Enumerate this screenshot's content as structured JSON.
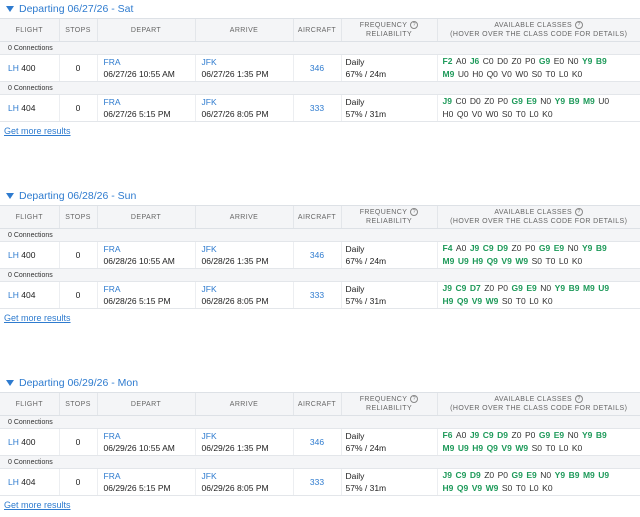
{
  "columns": {
    "flight": "FLIGHT",
    "stops": "STOPS",
    "depart": "DEPART",
    "arrive": "ARRIVE",
    "aircraft": "AIRCRAFT",
    "frequency_1": "FREQUENCY",
    "frequency_2": "RELIABILITY",
    "classes_1": "AVAILABLE CLASSES",
    "classes_2": "(HOVER OVER THE CLASS CODE FOR DETAILS)"
  },
  "get_more_label": "Get more results",
  "colors": {
    "accent": "#2e7bcf",
    "available": "#1e9a5a"
  },
  "sections": [
    {
      "title": "Departing 06/27/26 - Sat",
      "flights": [
        {
          "connections": "0 Connections",
          "airline": "LH",
          "number": "400",
          "stops": "0",
          "dep_airport": "FRA",
          "dep_time": "06/27/26 10:55 AM",
          "arr_airport": "JFK",
          "arr_time": "06/27/26 1:35 PM",
          "aircraft": "346",
          "frequency": "Daily",
          "reliability": "67% / 24m",
          "classes": [
            [
              [
                "F2",
                1
              ],
              [
                "A0",
                0
              ],
              [
                "J6",
                1
              ],
              [
                "C0",
                0
              ],
              [
                "D0",
                0
              ],
              [
                "Z0",
                0
              ],
              [
                "P0",
                0
              ],
              [
                "G9",
                1
              ],
              [
                "E0",
                0
              ],
              [
                "N0",
                0
              ],
              [
                "Y9",
                1
              ],
              [
                "B9",
                1
              ]
            ],
            [
              [
                "M9",
                1
              ],
              [
                "U0",
                0
              ],
              [
                "H0",
                0
              ],
              [
                "Q0",
                0
              ],
              [
                "V0",
                0
              ],
              [
                "W0",
                0
              ],
              [
                "S0",
                0
              ],
              [
                "T0",
                0
              ],
              [
                "L0",
                0
              ],
              [
                "K0",
                0
              ]
            ]
          ]
        },
        {
          "connections": "0 Connections",
          "airline": "LH",
          "number": "404",
          "stops": "0",
          "dep_airport": "FRA",
          "dep_time": "06/27/26 5:15 PM",
          "arr_airport": "JFK",
          "arr_time": "06/27/26 8:05 PM",
          "aircraft": "333",
          "frequency": "Daily",
          "reliability": "57% / 31m",
          "classes": [
            [
              [
                "J9",
                1
              ],
              [
                "C0",
                0
              ],
              [
                "D0",
                0
              ],
              [
                "Z0",
                0
              ],
              [
                "P0",
                0
              ],
              [
                "G9",
                1
              ],
              [
                "E9",
                1
              ],
              [
                "N0",
                0
              ],
              [
                "Y9",
                1
              ],
              [
                "B9",
                1
              ],
              [
                "M9",
                1
              ],
              [
                "U0",
                0
              ]
            ],
            [
              [
                "H0",
                0
              ],
              [
                "Q0",
                0
              ],
              [
                "V0",
                0
              ],
              [
                "W0",
                0
              ],
              [
                "S0",
                0
              ],
              [
                "T0",
                0
              ],
              [
                "L0",
                0
              ],
              [
                "K0",
                0
              ]
            ]
          ]
        }
      ]
    },
    {
      "title": "Departing 06/28/26 - Sun",
      "flights": [
        {
          "connections": "0 Connections",
          "airline": "LH",
          "number": "400",
          "stops": "0",
          "dep_airport": "FRA",
          "dep_time": "06/28/26 10:55 AM",
          "arr_airport": "JFK",
          "arr_time": "06/28/26 1:35 PM",
          "aircraft": "346",
          "frequency": "Daily",
          "reliability": "67% / 24m",
          "classes": [
            [
              [
                "F4",
                1
              ],
              [
                "A0",
                0
              ],
              [
                "J9",
                1
              ],
              [
                "C9",
                1
              ],
              [
                "D9",
                1
              ],
              [
                "Z0",
                0
              ],
              [
                "P0",
                0
              ],
              [
                "G9",
                1
              ],
              [
                "E9",
                1
              ],
              [
                "N0",
                0
              ],
              [
                "Y9",
                1
              ],
              [
                "B9",
                1
              ]
            ],
            [
              [
                "M9",
                1
              ],
              [
                "U9",
                1
              ],
              [
                "H9",
                1
              ],
              [
                "Q9",
                1
              ],
              [
                "V9",
                1
              ],
              [
                "W9",
                1
              ],
              [
                "S0",
                0
              ],
              [
                "T0",
                0
              ],
              [
                "L0",
                0
              ],
              [
                "K0",
                0
              ]
            ]
          ]
        },
        {
          "connections": "0 Connections",
          "airline": "LH",
          "number": "404",
          "stops": "0",
          "dep_airport": "FRA",
          "dep_time": "06/28/26 5:15 PM",
          "arr_airport": "JFK",
          "arr_time": "06/28/26 8:05 PM",
          "aircraft": "333",
          "frequency": "Daily",
          "reliability": "57% / 31m",
          "classes": [
            [
              [
                "J9",
                1
              ],
              [
                "C9",
                1
              ],
              [
                "D7",
                1
              ],
              [
                "Z0",
                0
              ],
              [
                "P0",
                0
              ],
              [
                "G9",
                1
              ],
              [
                "E9",
                1
              ],
              [
                "N0",
                0
              ],
              [
                "Y9",
                1
              ],
              [
                "B9",
                1
              ],
              [
                "M9",
                1
              ],
              [
                "U9",
                1
              ]
            ],
            [
              [
                "H9",
                1
              ],
              [
                "Q9",
                1
              ],
              [
                "V9",
                1
              ],
              [
                "W9",
                1
              ],
              [
                "S0",
                0
              ],
              [
                "T0",
                0
              ],
              [
                "L0",
                0
              ],
              [
                "K0",
                0
              ]
            ]
          ]
        }
      ]
    },
    {
      "title": "Departing 06/29/26 - Mon",
      "flights": [
        {
          "connections": "0 Connections",
          "airline": "LH",
          "number": "400",
          "stops": "0",
          "dep_airport": "FRA",
          "dep_time": "06/29/26 10:55 AM",
          "arr_airport": "JFK",
          "arr_time": "06/29/26 1:35 PM",
          "aircraft": "346",
          "frequency": "Daily",
          "reliability": "67% / 24m",
          "classes": [
            [
              [
                "F6",
                1
              ],
              [
                "A0",
                0
              ],
              [
                "J9",
                1
              ],
              [
                "C9",
                1
              ],
              [
                "D9",
                1
              ],
              [
                "Z0",
                0
              ],
              [
                "P0",
                0
              ],
              [
                "G9",
                1
              ],
              [
                "E9",
                1
              ],
              [
                "N0",
                0
              ],
              [
                "Y9",
                1
              ],
              [
                "B9",
                1
              ]
            ],
            [
              [
                "M9",
                1
              ],
              [
                "U9",
                1
              ],
              [
                "H9",
                1
              ],
              [
                "Q9",
                1
              ],
              [
                "V9",
                1
              ],
              [
                "W9",
                1
              ],
              [
                "S0",
                0
              ],
              [
                "T0",
                0
              ],
              [
                "L0",
                0
              ],
              [
                "K0",
                0
              ]
            ]
          ]
        },
        {
          "connections": "0 Connections",
          "airline": "LH",
          "number": "404",
          "stops": "0",
          "dep_airport": "FRA",
          "dep_time": "06/29/26 5:15 PM",
          "arr_airport": "JFK",
          "arr_time": "06/29/26 8:05 PM",
          "aircraft": "333",
          "frequency": "Daily",
          "reliability": "57% / 31m",
          "classes": [
            [
              [
                "J9",
                1
              ],
              [
                "C9",
                1
              ],
              [
                "D9",
                1
              ],
              [
                "Z0",
                0
              ],
              [
                "P0",
                0
              ],
              [
                "G9",
                1
              ],
              [
                "E9",
                1
              ],
              [
                "N0",
                0
              ],
              [
                "Y9",
                1
              ],
              [
                "B9",
                1
              ],
              [
                "M9",
                1
              ],
              [
                "U9",
                1
              ]
            ],
            [
              [
                "H9",
                1
              ],
              [
                "Q9",
                1
              ],
              [
                "V9",
                1
              ],
              [
                "W9",
                1
              ],
              [
                "S0",
                0
              ],
              [
                "T0",
                0
              ],
              [
                "L0",
                0
              ],
              [
                "K0",
                0
              ]
            ]
          ]
        }
      ]
    }
  ]
}
